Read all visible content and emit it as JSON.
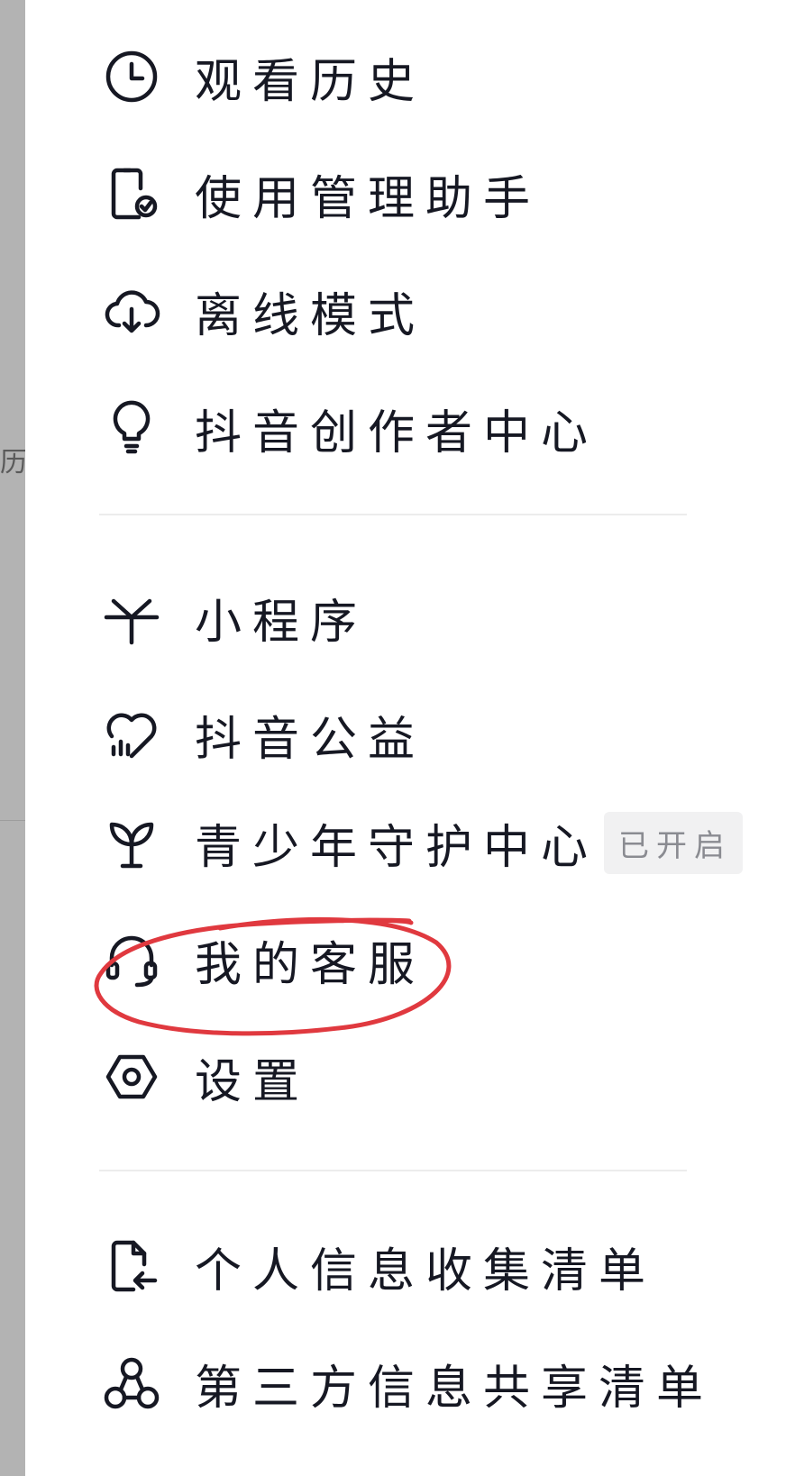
{
  "backdrop": {
    "peek_text": "历"
  },
  "menu": {
    "group1": [
      {
        "label": "观看历史",
        "icon": "clock-icon"
      },
      {
        "label": "使用管理助手",
        "icon": "phone-check-icon"
      },
      {
        "label": "离线模式",
        "icon": "cloud-download-icon"
      },
      {
        "label": "抖音创作者中心",
        "icon": "lightbulb-icon"
      }
    ],
    "group2": [
      {
        "label": "小程序",
        "icon": "mini-program-icon"
      },
      {
        "label": "抖音公益",
        "icon": "heart-chart-icon"
      },
      {
        "label": "青少年守护中心",
        "icon": "sprout-icon",
        "badge": "已开启"
      },
      {
        "label": "我的客服",
        "icon": "headset-icon"
      },
      {
        "label": "设置",
        "icon": "hexagon-gear-icon"
      }
    ],
    "group3": [
      {
        "label": "个人信息收集清单",
        "icon": "document-arrow-icon"
      },
      {
        "label": "第三方信息共享清单",
        "icon": "share-nodes-icon"
      }
    ]
  },
  "colors": {
    "text": "#161823",
    "annotation": "#e0393f",
    "badge_bg": "#f1f1f2",
    "badge_text": "#8a8b91",
    "divider": "#ececec",
    "backdrop": "#b3b3b3"
  }
}
